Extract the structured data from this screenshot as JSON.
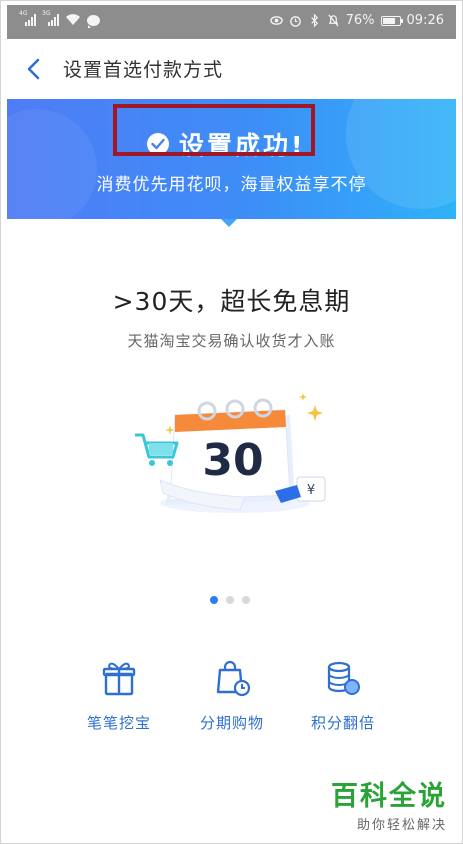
{
  "status_bar": {
    "signal1_tag": "4G",
    "signal2_tag": "3G",
    "battery": "76%",
    "time": "09:26"
  },
  "header": {
    "title": "设置首选付款方式"
  },
  "banner": {
    "success_text": "设置成功!",
    "subtitle": "消费优先用花呗，海量权益享不停"
  },
  "promo": {
    "title": ">30天，超长免息期",
    "subtitle": "天猫淘宝交易确认收货才入账",
    "calendar_number": "30",
    "currency_symbol": "¥"
  },
  "carousel": {
    "pages": 3,
    "active_index": 0
  },
  "features": [
    {
      "label": "笔笔挖宝",
      "icon": "gift-icon"
    },
    {
      "label": "分期购物",
      "icon": "shopping-bag-clock-icon"
    },
    {
      "label": "积分翻倍",
      "icon": "coin-stack-icon"
    }
  ],
  "watermark": {
    "main": "百科全说",
    "sub": "助你轻松解决"
  },
  "colors": {
    "banner_start": "#4f7cf6",
    "banner_end": "#2eb2f8",
    "accent_blue": "#2f6fd1",
    "highlight_box": "#a01826",
    "watermark_green": "#2aa336"
  }
}
